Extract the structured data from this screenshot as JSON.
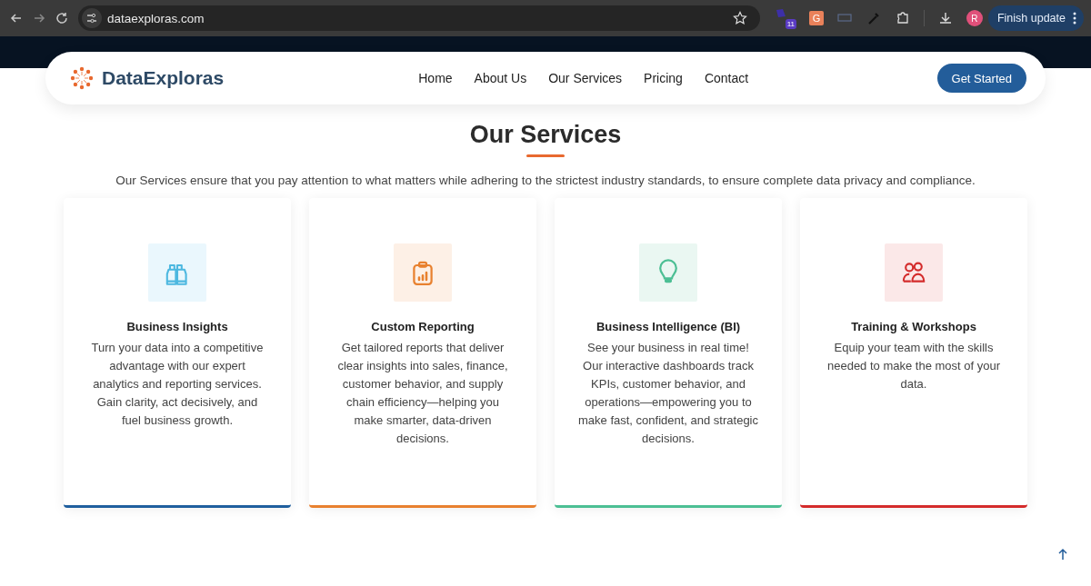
{
  "browser": {
    "url": "dataexploras.com",
    "extension_badge": "11",
    "extension_letter": "G",
    "profile_initial": "R",
    "update_button": "Finish update"
  },
  "nav": {
    "brand": "DataExploras",
    "links": [
      {
        "label": "Home"
      },
      {
        "label": "About Us"
      },
      {
        "label": "Our Services"
      },
      {
        "label": "Pricing"
      },
      {
        "label": "Contact"
      }
    ],
    "cta": "Get Started"
  },
  "section": {
    "title": "Our Services",
    "intro": "Our Services ensure that you pay attention to what matters while adhering to the strictest industry standards, to ensure complete data privacy and compliance."
  },
  "cards": [
    {
      "kind": "binoculars",
      "color": "#1f5f9e",
      "title": "Business Insights",
      "text": "Turn your data into a competitive advantage with our expert analytics and reporting services. Gain clarity, act decisively, and fuel business growth."
    },
    {
      "kind": "report",
      "color": "#e8812f",
      "title": "Custom Reporting",
      "text": "Get tailored reports that deliver clear insights into sales, finance, customer behavior, and supply chain efficiency—helping you make smarter, data-driven decisions."
    },
    {
      "kind": "bulb",
      "color": "#4cbf94",
      "title": "Business Intelligence (BI)",
      "text": "See your business in real time! Our interactive dashboards track KPIs, customer behavior, and operations—empowering you to make fast, confident, and strategic decisions."
    },
    {
      "kind": "people",
      "color": "#d42b2b",
      "title": "Training & Workshops",
      "text": "Equip your team with the skills needed to make the most of your data."
    }
  ]
}
